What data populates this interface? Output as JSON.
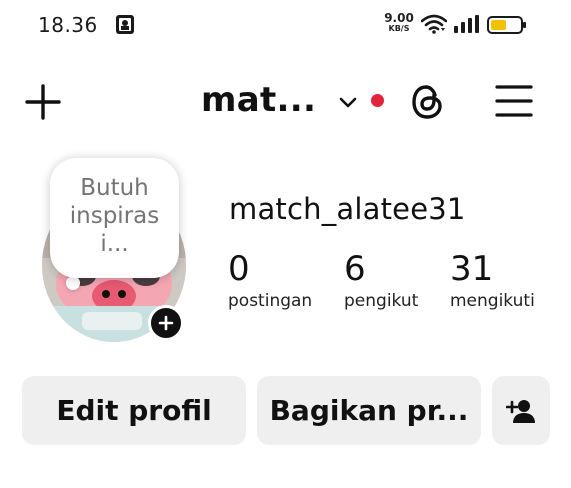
{
  "status_bar": {
    "time": "18.36",
    "net_speed_value": "9.00",
    "net_speed_unit": "KB/S",
    "battery_level": 0.55,
    "battery_color": "#f2c200"
  },
  "header": {
    "username_short": "mat...",
    "notification_dot_color": "#e0243c",
    "icons": [
      "plus-icon",
      "chevron-down-icon",
      "threads-icon",
      "menu-icon"
    ]
  },
  "note": {
    "lines": [
      "Butuh",
      "inspiras",
      "i..."
    ]
  },
  "profile": {
    "username": "match_alatee31",
    "stats": [
      {
        "value": "0",
        "label": "postingan"
      },
      {
        "value": "6",
        "label": "pengikut"
      },
      {
        "value": "31",
        "label": "mengikuti"
      }
    ]
  },
  "actions": {
    "edit_label": "Edit profil",
    "share_label": "Bagikan pr...",
    "add_user_icon": "add-user-icon"
  }
}
